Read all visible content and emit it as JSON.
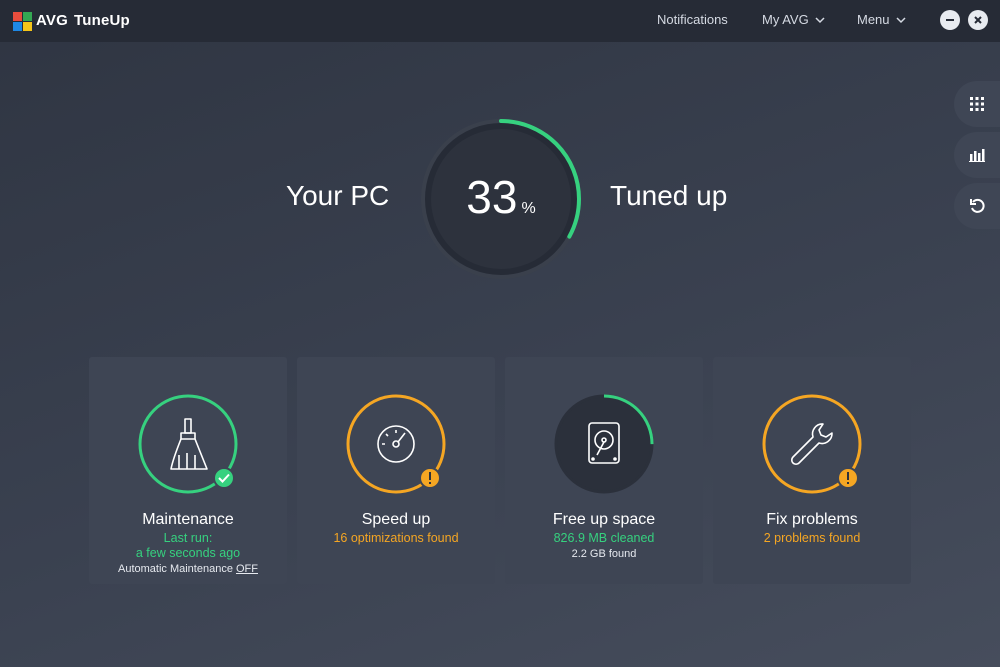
{
  "app": {
    "logo_text": "AVG",
    "name": "TuneUp"
  },
  "topnav": {
    "notifications": "Notifications",
    "myavg": "My AVG",
    "menu": "Menu"
  },
  "hero": {
    "left": "Your PC",
    "right": "Tuned up",
    "value": "33",
    "unit": "%",
    "progress": 0.33
  },
  "colors": {
    "accent_green": "#36d17f",
    "accent_orange": "#f5a623"
  },
  "cards": [
    {
      "title": "Maintenance",
      "line1": "Last run:",
      "line2": "a few seconds ago",
      "line3_prefix": "Automatic Maintenance",
      "line3_link": "OFF",
      "status": "ok",
      "icon": "broom-icon"
    },
    {
      "title": "Speed up",
      "line1": "16 optimizations found",
      "status": "warning",
      "icon": "speedometer-icon"
    },
    {
      "title": "Free up space",
      "line1": "826.9 MB cleaned",
      "line2": "2.2 GB found",
      "progress": 0.25,
      "icon": "hard-drive-icon"
    },
    {
      "title": "Fix problems",
      "line1": "2 problems found",
      "status": "warning",
      "icon": "wrench-icon"
    }
  ],
  "side": {
    "items": [
      "apps-grid-icon",
      "bar-chart-icon",
      "undo-icon"
    ]
  }
}
